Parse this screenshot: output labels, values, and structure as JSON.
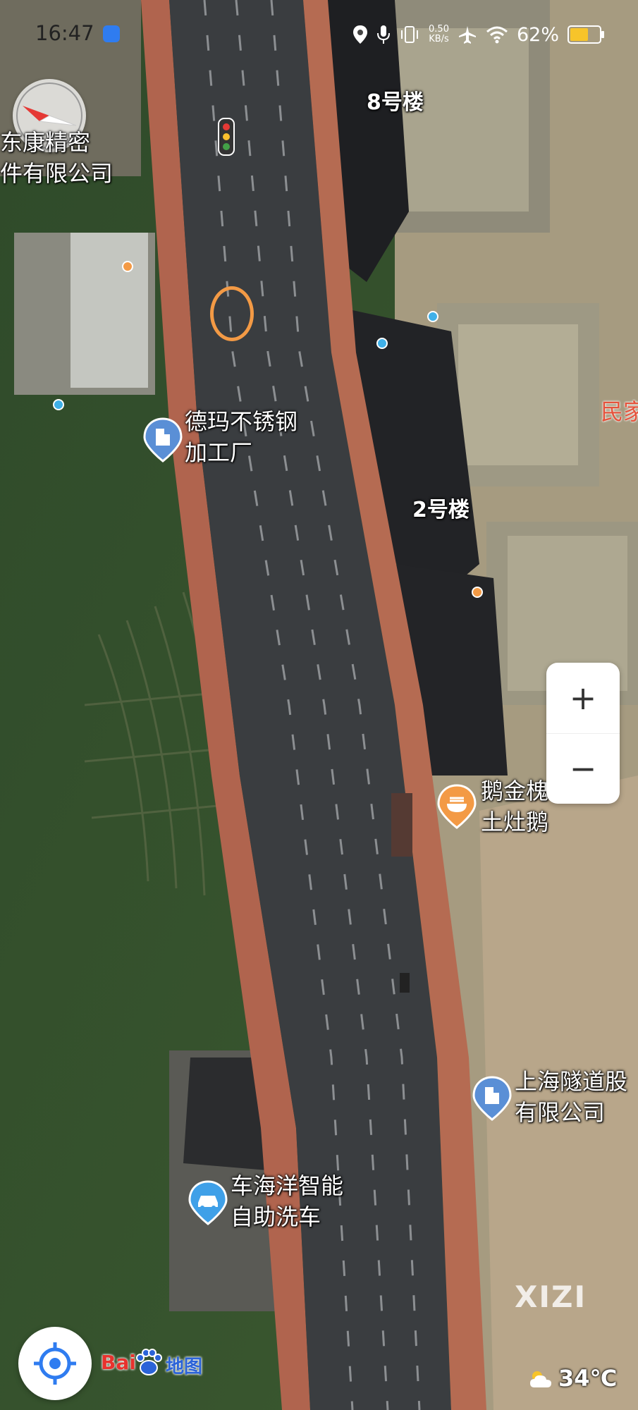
{
  "status_bar": {
    "time": "16:47",
    "net_speed_value": "0.50",
    "net_speed_unit": "KB/s",
    "battery_percent": "62%",
    "battery_level": 0.62,
    "icons": [
      "app-indicator-icon",
      "location-icon",
      "microphone-icon",
      "vibrate-icon",
      "airplane-icon",
      "wifi-icon",
      "battery-icon"
    ]
  },
  "map": {
    "poi": {
      "kangjingmi_line1": "东康精密",
      "kangjingmi_line2": "件有限公司",
      "building8": "8号楼",
      "minjia": "民家",
      "dema_line1": "德玛不锈钢",
      "dema_line2": "加工厂",
      "building2": "2号楼",
      "ejin_line1": "鹅金槐农家",
      "ejin_line2": "土灶鹅",
      "tunnel_line1": "上海隧道股",
      "tunnel_line2": "有限公司",
      "carwash_line1": "车海洋智能",
      "carwash_line2": "自助洗车"
    },
    "controls": {
      "zoom_in": "+",
      "zoom_out": "−"
    },
    "branding": {
      "logo_bai": "Bai",
      "logo_ditu": "地图",
      "watermark": "XIZI"
    },
    "weather": {
      "temperature": "34℃",
      "icon": "partly-cloudy-icon"
    },
    "colors": {
      "accent_blue": "#2f7cf0",
      "poi_orange": "#f39a45",
      "poi_blue": "#5a8fd6"
    }
  }
}
